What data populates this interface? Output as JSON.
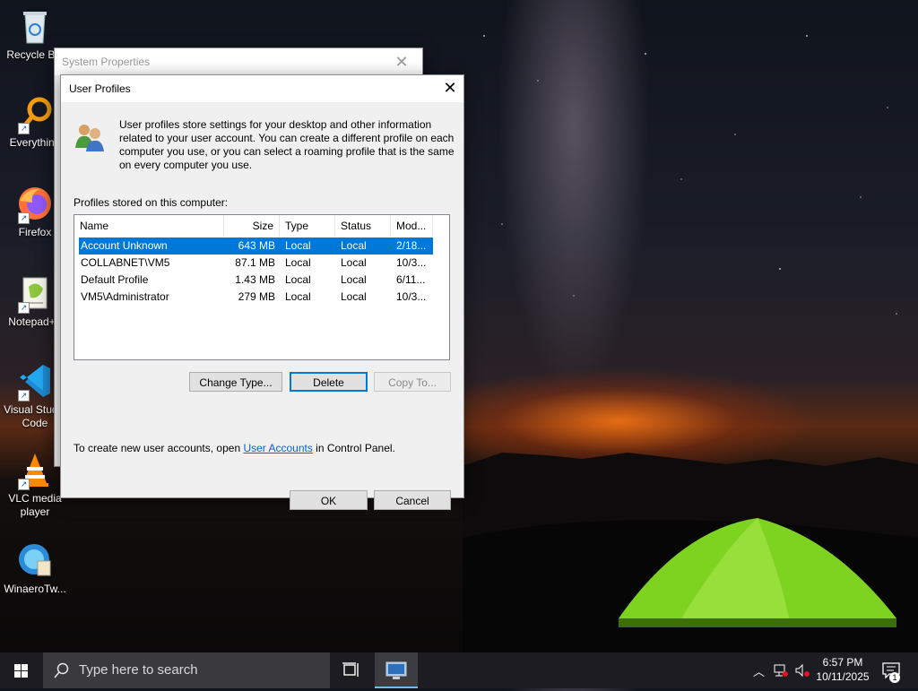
{
  "desktop": {
    "icons": [
      {
        "label": "Recycle Bin",
        "icon": "recycle-bin-icon"
      },
      {
        "label": "Everything",
        "icon": "everything-search-icon"
      },
      {
        "label": "Firefox",
        "icon": "firefox-icon"
      },
      {
        "label": "Notepad++",
        "icon": "notepad-plus-plus-icon"
      },
      {
        "label": "Visual Studio Code",
        "icon": "vscode-icon"
      },
      {
        "label": "VLC media player",
        "icon": "vlc-icon"
      },
      {
        "label": "WinaeroTw...",
        "icon": "winaero-tweaker-icon"
      }
    ]
  },
  "system_properties": {
    "title": "System Properties"
  },
  "dialog": {
    "title": "User Profiles",
    "description": "User profiles store settings for your desktop and other information related to your user account. You can create a different profile on each computer you use, or you can select a roaming profile that is the same on every computer you use.",
    "profiles_label": "Profiles stored on this computer:",
    "columns": [
      "Name",
      "Size",
      "Type",
      "Status",
      "Mod..."
    ],
    "rows": [
      {
        "name": "Account Unknown",
        "size": "643 MB",
        "type": "Local",
        "status": "Local",
        "modified": "2/18...",
        "selected": true
      },
      {
        "name": "COLLABNET\\VM5",
        "size": "87.1 MB",
        "type": "Local",
        "status": "Local",
        "modified": "10/3...",
        "selected": false
      },
      {
        "name": "Default Profile",
        "size": "1.43 MB",
        "type": "Local",
        "status": "Local",
        "modified": "6/11...",
        "selected": false
      },
      {
        "name": "VM5\\Administrator",
        "size": "279 MB",
        "type": "Local",
        "status": "Local",
        "modified": "10/3...",
        "selected": false
      }
    ],
    "buttons": {
      "change_type": "Change Type...",
      "delete": "Delete",
      "copy_to": "Copy To...",
      "ok": "OK",
      "cancel": "Cancel"
    },
    "footer": {
      "before": "To create new user accounts, open ",
      "link": "User Accounts",
      "after": " in Control Panel."
    }
  },
  "taskbar": {
    "search_placeholder": "Type here to search",
    "time": "6:57 PM",
    "date": "10/11/2025",
    "notification_count": "1"
  },
  "colors": {
    "selection": "#0078d7",
    "link": "#0066cc",
    "taskbar": "#1c1c22"
  }
}
